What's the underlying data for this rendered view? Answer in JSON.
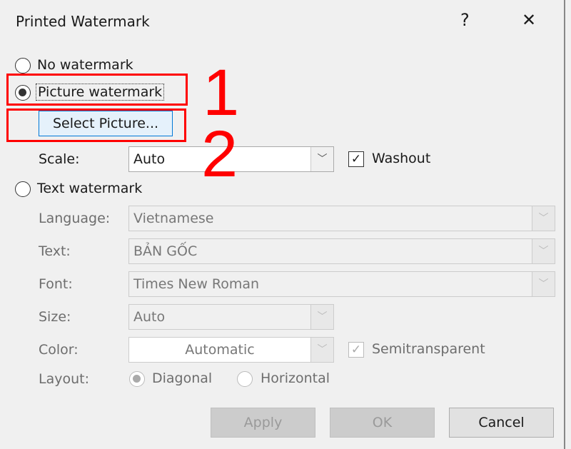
{
  "dialog": {
    "title": "Printed Watermark",
    "help": "?",
    "close": "✕"
  },
  "options": {
    "no_watermark": "No watermark",
    "picture_watermark": "Picture watermark",
    "select_picture": "Select Picture...",
    "scale_label": "Scale:",
    "scale_value": "Auto",
    "washout": "Washout",
    "text_watermark": "Text watermark",
    "selected": "picture_watermark",
    "washout_checked": true
  },
  "text_fields": {
    "language_label": "Language:",
    "language_value": "Vietnamese",
    "text_label": "Text:",
    "text_value": "BẢN GỐC",
    "font_label": "Font:",
    "font_value": "Times New Roman",
    "size_label": "Size:",
    "size_value": "Auto",
    "color_label": "Color:",
    "color_value": "Automatic",
    "semitransparent": "Semitransparent",
    "semitransparent_checked": true,
    "layout_label": "Layout:",
    "diagonal": "Diagonal",
    "horizontal": "Horizontal",
    "layout_selected": "diagonal"
  },
  "buttons": {
    "apply": "Apply",
    "ok": "OK",
    "cancel": "Cancel"
  },
  "annotations": {
    "step1": "1",
    "step2": "2",
    "color": "#ff0000"
  }
}
